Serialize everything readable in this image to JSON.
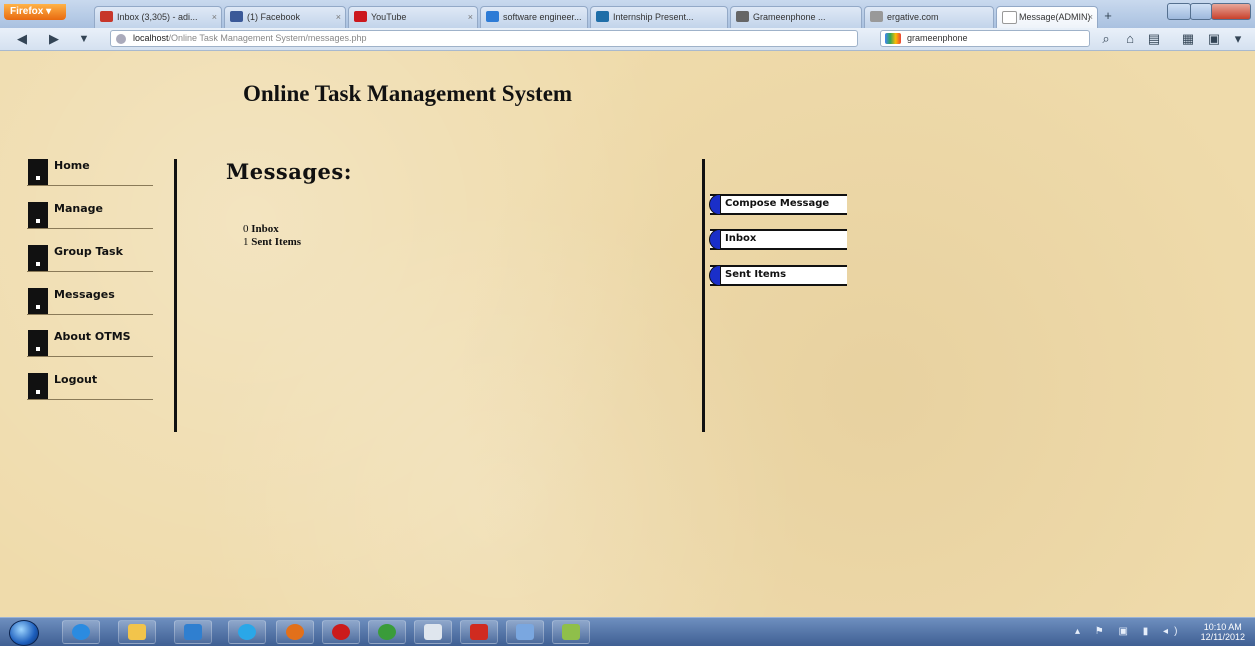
{
  "browser": {
    "menu_label": "Firefox ▾",
    "tabs": [
      {
        "title": "Inbox (3,305) - adi...",
        "icon": "gmail-icon",
        "color": "#c7362a"
      },
      {
        "title": "(1) Facebook",
        "icon": "facebook-icon",
        "color": "#3b5998"
      },
      {
        "title": "YouTube",
        "icon": "youtube-icon",
        "color": "#cc181e"
      },
      {
        "title": "software engineer...",
        "icon": "search-engine-icon",
        "color": "#2d7bd6"
      },
      {
        "title": "Internship Present...",
        "icon": "slideshare-icon",
        "color": "#1f6ea8"
      },
      {
        "title": "Grameenphone ...",
        "icon": "wikipedia-icon",
        "color": "#666666"
      },
      {
        "title": "ergative.com",
        "icon": "page-icon",
        "color": "#999999"
      },
      {
        "title": "Message(ADMIN)",
        "icon": "page-icon",
        "color": "#ffffff",
        "active": true
      }
    ],
    "new_tab": "+",
    "url_host": "localhost",
    "url_path": "/Online Task Management System/messages.php",
    "search_value": "grameenphone"
  },
  "page": {
    "title": "Online Task Management System",
    "left_menu": [
      "Home",
      "Manage",
      "Group Task",
      "Messages",
      "About OTMS",
      "Logout"
    ],
    "heading": "Messages:",
    "counts": [
      {
        "count": "0",
        "label": "Inbox"
      },
      {
        "count": "1",
        "label": "Sent Items"
      }
    ],
    "right_menu": [
      "Compose Message",
      "Inbox",
      "Sent Items"
    ]
  },
  "taskbar": {
    "time": "10:10 AM",
    "date": "12/11/2012",
    "apps": [
      {
        "name": "internet-explorer-icon",
        "color": "#2b8be0"
      },
      {
        "name": "file-explorer-icon",
        "color": "#f2c44b"
      },
      {
        "name": "media-player-icon",
        "color": "#2f7fd0"
      },
      {
        "name": "skype-icon",
        "color": "#2aa7e8"
      },
      {
        "name": "firefox-icon",
        "color": "#e2701a"
      },
      {
        "name": "opera-icon",
        "color": "#cc1b1b"
      },
      {
        "name": "chrome-icon",
        "color": "#3a9c3a"
      },
      {
        "name": "notepad-icon",
        "color": "#dfe6ee"
      },
      {
        "name": "acrobat-icon",
        "color": "#d02b20"
      },
      {
        "name": "paint-icon",
        "color": "#7aa7e0"
      },
      {
        "name": "image-editor-icon",
        "color": "#8fbf4a"
      }
    ]
  }
}
